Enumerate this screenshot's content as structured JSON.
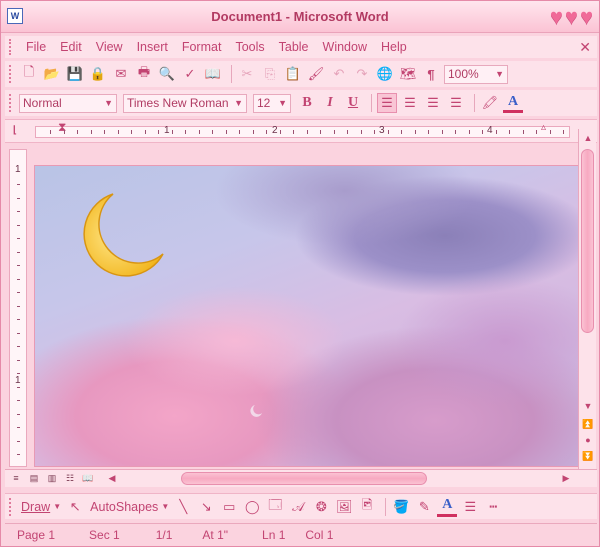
{
  "window": {
    "title": "Document1 - Microsoft Word",
    "app_icon": "W"
  },
  "menu": {
    "items": [
      "File",
      "Edit",
      "View",
      "Insert",
      "Format",
      "Tools",
      "Table",
      "Window",
      "Help"
    ],
    "close_glyph": "✕"
  },
  "standard_toolbar": {
    "zoom": "100%",
    "show_hide_glyph": "¶"
  },
  "formatting_toolbar": {
    "style": "Normal",
    "font": "Times New Roman",
    "size": "12",
    "bold": "B",
    "italic": "I",
    "underline": "U",
    "font_color_glyph": "A"
  },
  "ruler": {
    "numbers": [
      "1",
      "2",
      "3",
      "4"
    ],
    "vertical_numbers": [
      "1",
      "1"
    ]
  },
  "drawing_toolbar": {
    "draw_label": "Draw",
    "autoshapes_label": "AutoShapes",
    "font_color_glyph": "A"
  },
  "status": {
    "page": "Page 1",
    "sec": "Sec 1",
    "pages": "1/1",
    "at": "At 1\"",
    "ln": "Ln 1",
    "col": "Col 1"
  },
  "colors": {
    "accent": "#c24472",
    "chrome": "#fde2ea",
    "heart": "#f06a98"
  }
}
